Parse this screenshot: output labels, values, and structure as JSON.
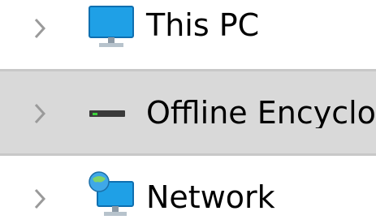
{
  "tree": {
    "items": [
      {
        "label": "This PC",
        "icon": "monitor-icon",
        "expanded": false,
        "selected": false
      },
      {
        "label": "Offline Encyclop",
        "icon": "drive-icon",
        "expanded": false,
        "selected": true
      },
      {
        "label": "Network",
        "icon": "network-icon",
        "expanded": false,
        "selected": false
      }
    ]
  },
  "colors": {
    "selection_bg": "#d9d9d9",
    "selection_border": "#c8c8c8",
    "chevron": "#9a9a9a",
    "monitor_screen": "#1fa0e6",
    "drive_light": "#3bd23b"
  }
}
